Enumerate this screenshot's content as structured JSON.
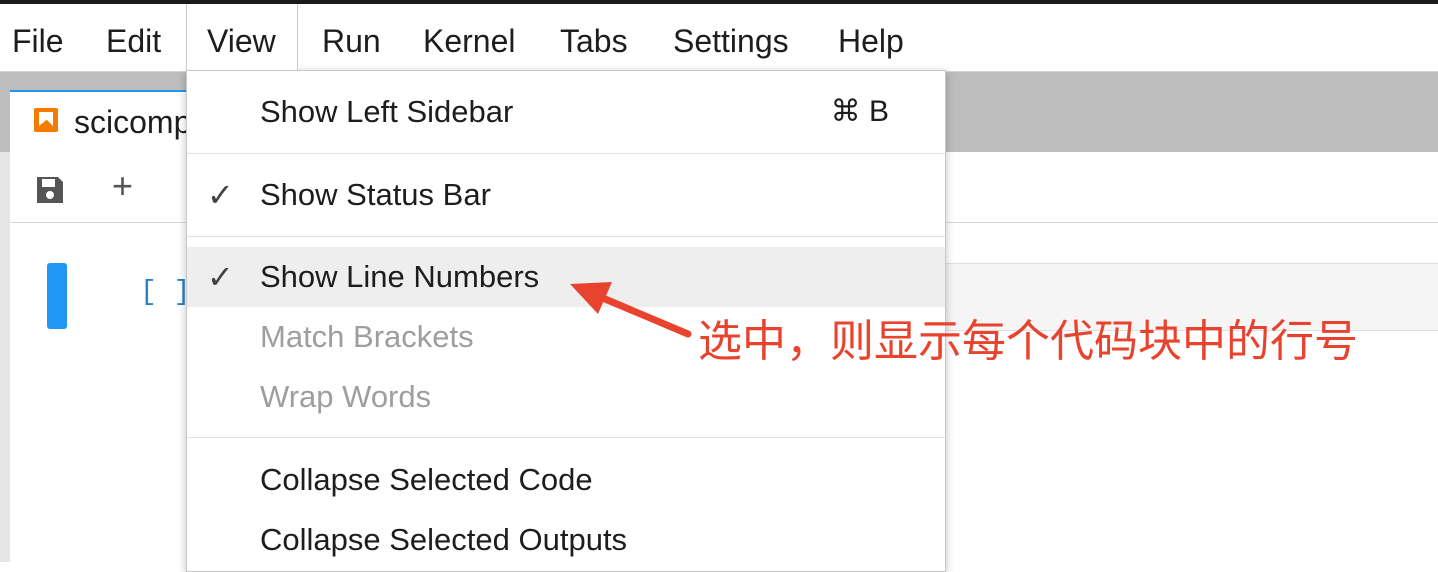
{
  "menubar": {
    "items": [
      {
        "label": "File"
      },
      {
        "label": "Edit"
      },
      {
        "label": "View"
      },
      {
        "label": "Run"
      },
      {
        "label": "Kernel"
      },
      {
        "label": "Tabs"
      },
      {
        "label": "Settings"
      },
      {
        "label": "Help"
      }
    ],
    "active": "View"
  },
  "tab": {
    "label": "scicomp",
    "icon": "notebook-icon"
  },
  "toolbar": {
    "save_icon": "save-icon",
    "add_label": "+"
  },
  "cell": {
    "prompt": "[ ]"
  },
  "view_menu": {
    "items": [
      {
        "label": "Show Left Sidebar",
        "shortcut": "⌘ B",
        "checked": false,
        "disabled": false
      },
      {
        "label": "Show Status Bar",
        "checked": true,
        "disabled": false
      },
      {
        "label": "Show Line Numbers",
        "checked": true,
        "disabled": false,
        "highlighted": true
      },
      {
        "label": "Match Brackets",
        "checked": false,
        "disabled": true
      },
      {
        "label": "Wrap Words",
        "checked": false,
        "disabled": true
      },
      {
        "label": "Collapse Selected Code",
        "checked": false,
        "disabled": false
      },
      {
        "label": "Collapse Selected Outputs",
        "checked": false,
        "disabled": false
      }
    ],
    "check_glyph": "✓"
  },
  "annotation": {
    "text": "选中，则显示每个代码块中的行号",
    "color": "#e8432e"
  },
  "colors": {
    "accent": "#2196f3",
    "tab_icon": "#f57c00",
    "prompt": "#307fc1"
  }
}
